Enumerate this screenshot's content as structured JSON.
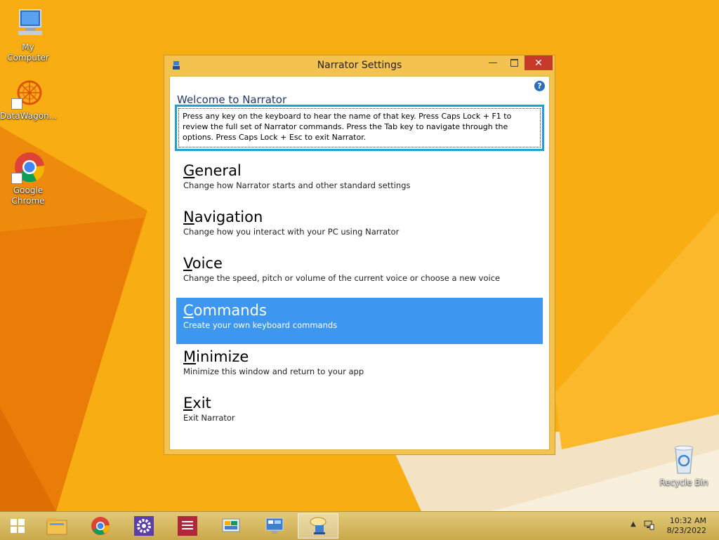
{
  "desktop": {
    "icons": [
      {
        "label": "My Computer"
      },
      {
        "label": "DataWagon..."
      },
      {
        "label": "Google Chrome"
      },
      {
        "label": "Recycle Bin"
      }
    ]
  },
  "window": {
    "title": "Narrator Settings",
    "help_glyph": "?",
    "welcome": "Welcome to Narrator",
    "info": "Press any key on the keyboard to hear the name of that key.  Press Caps Lock + F1 to review the full set of Narrator commands.  Press the Tab key to navigate through the options.  Press Caps Lock + Esc to exit Narrator.",
    "options": [
      {
        "key": "G",
        "rest": "eneral",
        "desc": "Change how Narrator starts and other standard settings"
      },
      {
        "key": "N",
        "rest": "avigation",
        "desc": "Change how you interact with your PC using Narrator"
      },
      {
        "key": "V",
        "rest": "oice",
        "desc": "Change the speed, pitch or volume of the current voice or choose a new voice"
      },
      {
        "key": "C",
        "rest": "ommands",
        "desc": "Create your own keyboard commands"
      },
      {
        "key": "M",
        "rest": "inimize",
        "desc": "Minimize this window and return to your app"
      },
      {
        "key": "E",
        "rest": "xit",
        "desc": "Exit Narrator"
      }
    ],
    "selected_option": "Commands"
  },
  "taskbar": {
    "clock_time": "10:32 AM",
    "clock_date": "8/23/2022"
  },
  "colors": {
    "desktop_bg": "#f7a90f",
    "selection": "#3d97f0",
    "focus_border": "#1ea0d4",
    "close_button": "#c7392b"
  }
}
